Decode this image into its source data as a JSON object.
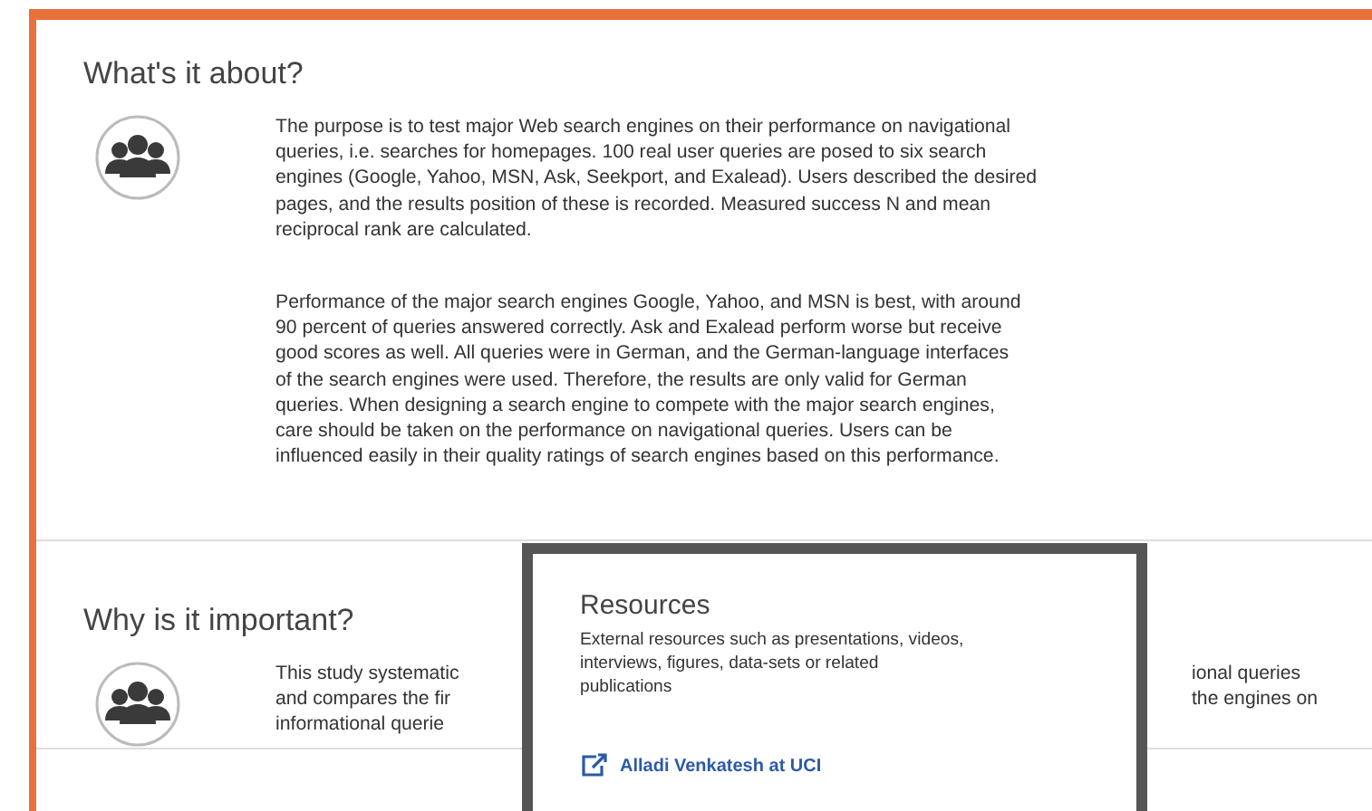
{
  "sections": [
    {
      "heading": "What's it about?",
      "paragraphs": [
        [
          "The purpose is to test major Web search engines on their performance on navigational",
          "queries, i.e. searches for homepages. 100 real user queries are posed to six search",
          "engines (Google, Yahoo, MSN, Ask, Seekport, and Exalead). Users described the desired",
          "pages, and the results position of these is recorded. Measured success N and mean",
          "reciprocal rank are calculated."
        ],
        [
          "Performance of the major search engines Google, Yahoo, and MSN is best, with around",
          "90 percent of queries answered correctly. Ask and Exalead perform worse but receive",
          "good scores as well. All queries were in German, and the German-language interfaces",
          "of the search engines were used. Therefore, the results are only valid for German",
          "queries. When designing a search engine to compete with the major search engines,",
          "care should be taken on the performance on navigational queries. Users can be",
          "influenced easily in their quality ratings of search engines based on this performance."
        ]
      ]
    },
    {
      "heading": "Why is it important?",
      "visible_left": [
        "This study systematic",
        "and compares the fir",
        "informational querie"
      ],
      "visible_right": [
        "ional queries",
        "the engines on"
      ]
    }
  ],
  "popup": {
    "title": "Resources",
    "description": "External resources such as presentations, videos, interviews, figures, data-sets or related publications",
    "links": [
      "Alladi Venkatesh at UCI"
    ]
  }
}
